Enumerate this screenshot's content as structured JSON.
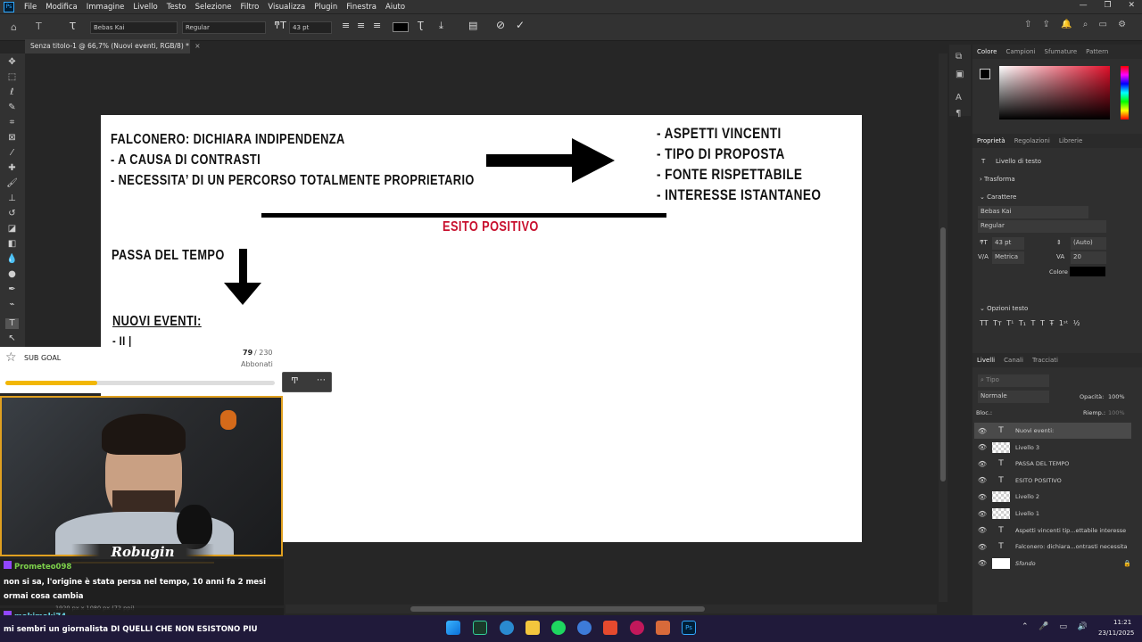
{
  "menu": [
    "File",
    "Modifica",
    "Immagine",
    "Livello",
    "Testo",
    "Selezione",
    "Filtro",
    "Visualizza",
    "Plugin",
    "Finestra",
    "Aiuto"
  ],
  "options": {
    "font_family": "Bebas Kai",
    "font_style": "Regular",
    "font_size": "43 pt"
  },
  "document_tab": "Senza titolo-1 @ 66,7% (Nuovi eventi, RGB/8) *",
  "canvas": {
    "line1": "FALCONERO: DICHIARA INDIPENDENZA",
    "line2": "-  A CAUSA DI CONTRASTI",
    "line3": "-  NECESSITA’ DI UN PERCORSO TOTALMENTE PROPRIETARIO",
    "right1": "-  ASPETTI VINCENTI",
    "right2": "-  TIPO DI PROPOSTA",
    "right3": "-  FONTE RISPETTABILE",
    "right4": "-  INTERESSE ISTANTANEO",
    "esito": "ESITO POSITIVO",
    "passa": "PASSA DEL TEMPO",
    "nuovi": "NUOVI EVENTI:",
    "bullet": "-  II |"
  },
  "panels": {
    "color_tabs": [
      "Colore",
      "Campioni",
      "Sfumature",
      "Pattern"
    ],
    "prop_tabs": [
      "Proprietà",
      "Regolazioni",
      "Librerie"
    ],
    "layer_type": "Livello di testo",
    "transform": "Trasforma",
    "character": "Carattere",
    "font": "Bebas Kai",
    "style": "Regular",
    "size": "43 pt",
    "leading": "(Auto)",
    "kerning": "Metrica",
    "tracking": "20",
    "color_label": "Colore",
    "text_options": "Opzioni testo",
    "layers_tabs": [
      "Livelli",
      "Canali",
      "Tracciati"
    ],
    "search_placeholder": "Tipo",
    "blend": "Normale",
    "opacity_label": "Opacità:",
    "opacity": "100%",
    "lock_label": "Bloc.:",
    "fill_label": "Riemp.:",
    "fill": "100%"
  },
  "layers": [
    {
      "name": "Nuovi eventi:",
      "kind": "text"
    },
    {
      "name": "Livello 3",
      "kind": "pixel"
    },
    {
      "name": "PASSA DEL TEMPO",
      "kind": "text"
    },
    {
      "name": "ESITO POSITIVO",
      "kind": "text"
    },
    {
      "name": "Livello 2",
      "kind": "pixel"
    },
    {
      "name": "Livello 1",
      "kind": "pixel"
    },
    {
      "name": "Aspetti vincenti tip...ettabile interesse",
      "kind": "text"
    },
    {
      "name": "Falconero: dichiara...ontrasti necessita",
      "kind": "text"
    },
    {
      "name": "Sfondo",
      "kind": "background"
    }
  ],
  "overlay": {
    "sub_goal": "SUB GOAL",
    "sub_current": "79",
    "sub_target": "/ 230",
    "sub_label": "Abbonati",
    "sub_progress": 0.34,
    "streamer": "Robugin",
    "chat": [
      {
        "user": "Prometeo098",
        "msg": "non si sa, l'origine è stata persa nel tempo, 10 anni fa 2 mesi ormai cosa cambia"
      },
      {
        "user": "makimaki74",
        "msg": "mi sembri un giornalista DI QUELLI CHE NON ESISTONO PIU"
      }
    ]
  },
  "status": "1920 px x 1080 px (72 ppi)",
  "clock": {
    "time": "11:21",
    "date": "23/11/2025"
  },
  "colors": {
    "accent_red": "#c8102e",
    "goal_yellow": "#f2b705",
    "taskbar": "#201a3a"
  }
}
